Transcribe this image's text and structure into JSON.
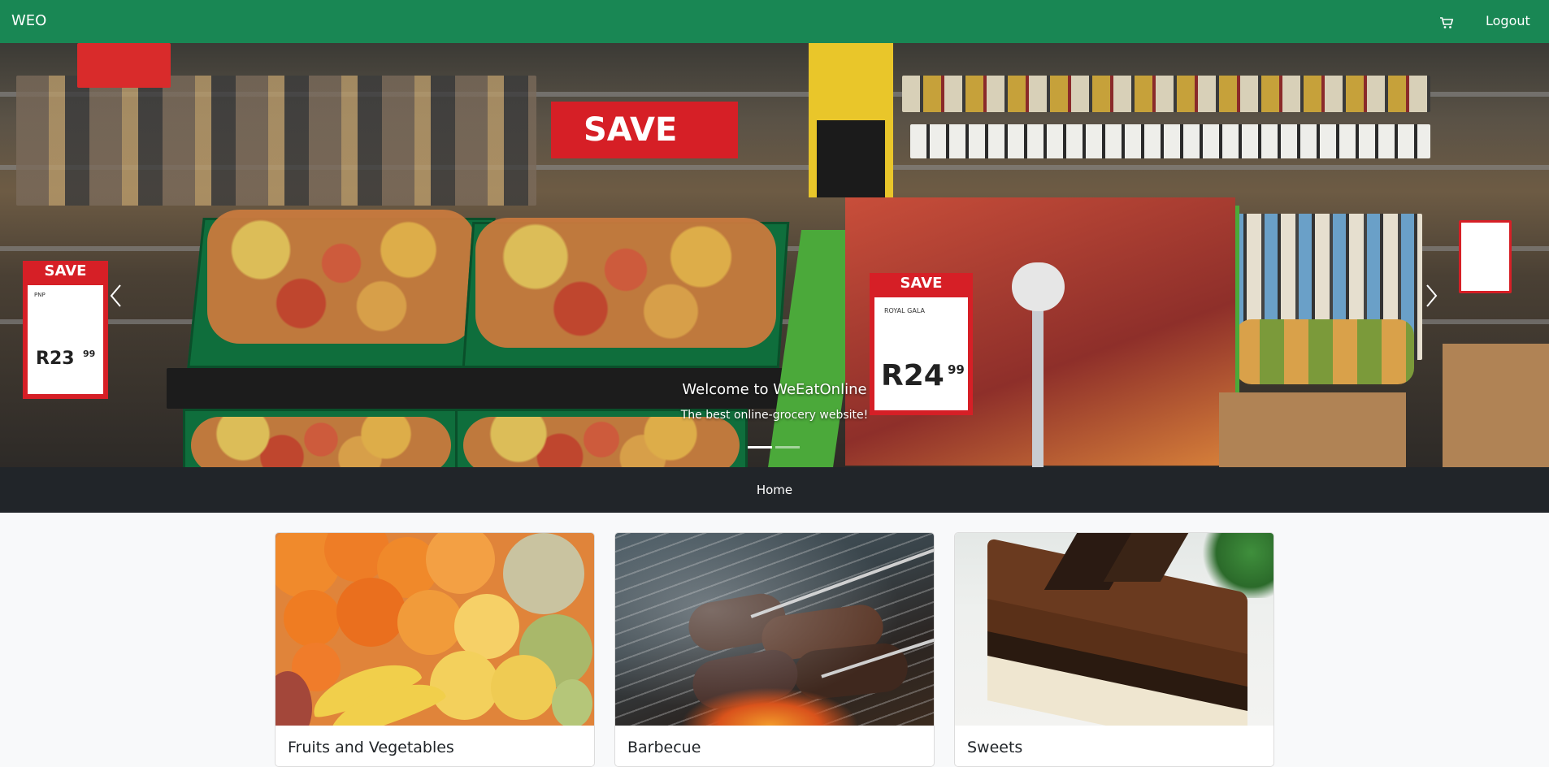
{
  "navbar": {
    "brand": "WEO",
    "cart_icon": "cart-icon",
    "logout_label": "Logout",
    "background": "#198754"
  },
  "carousel": {
    "caption_title": "Welcome to WeEatOnline",
    "caption_subtitle": "The best online-grocery website!",
    "slide_count": 2,
    "active_slide": 1,
    "prev_icon": "chevron-left-icon",
    "next_icon": "chevron-right-icon",
    "scene_signs": {
      "save": "SAVE",
      "left_price": "R23",
      "left_cents": "99",
      "left_small": "PNP",
      "right_price": "R24",
      "right_cents": "99",
      "right_small": "ROYAL GALA"
    }
  },
  "subnav": {
    "home_label": "Home",
    "background": "#212529"
  },
  "categories": [
    {
      "title": "Fruits and Vegetables",
      "image": "fruits-vegetables-photo"
    },
    {
      "title": "Barbecue",
      "image": "barbecue-grill-photo"
    },
    {
      "title": "Sweets",
      "image": "chocolate-cake-photo"
    }
  ]
}
